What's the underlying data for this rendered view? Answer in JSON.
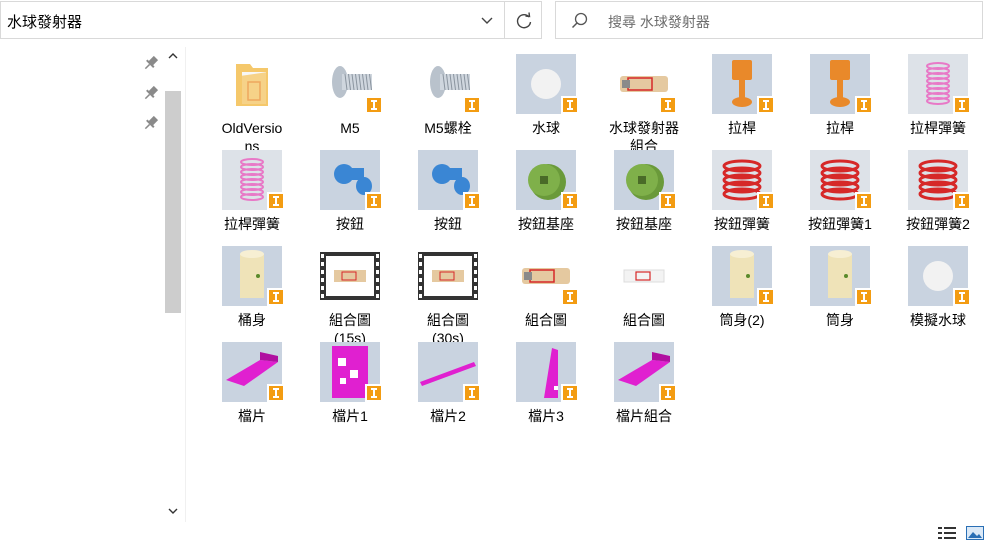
{
  "address": {
    "path": "水球發射器"
  },
  "search": {
    "placeholder": "搜尋 水球發射器"
  },
  "items": [
    {
      "label": "OldVersions",
      "display": "OldVersio\nns",
      "kind": "folder"
    },
    {
      "label": "M5",
      "kind": "screw"
    },
    {
      "label": "M5螺栓",
      "kind": "screw"
    },
    {
      "label": "水球",
      "kind": "ball"
    },
    {
      "label": "水球發射器組合",
      "display": "水球發射器\n組合",
      "kind": "assembly-cut"
    },
    {
      "label": "拉桿",
      "kind": "pull-rod"
    },
    {
      "label": "拉桿",
      "kind": "pull-rod"
    },
    {
      "label": "拉桿彈簧",
      "kind": "spring-pink"
    },
    {
      "label": "拉桿彈簧",
      "kind": "spring-pink"
    },
    {
      "label": "按鈕",
      "kind": "button-blue"
    },
    {
      "label": "按鈕",
      "kind": "button-blue"
    },
    {
      "label": "按鈕基座",
      "kind": "base-green"
    },
    {
      "label": "按鈕基座",
      "kind": "base-green"
    },
    {
      "label": "按鈕彈簧",
      "kind": "spring-red"
    },
    {
      "label": "按鈕彈簧1",
      "kind": "spring-red"
    },
    {
      "label": "按鈕彈簧2",
      "kind": "spring-red"
    },
    {
      "label": "桶身",
      "kind": "tube"
    },
    {
      "label": "組合圖(15s)",
      "display": "組合圖\n(15s)",
      "kind": "video"
    },
    {
      "label": "組合圖(30s)",
      "display": "組合圖\n(30s)",
      "kind": "video"
    },
    {
      "label": "組合圖",
      "kind": "assembly-cut"
    },
    {
      "label": "組合圖",
      "kind": "assembly-flat"
    },
    {
      "label": "筒身(2)",
      "kind": "tube"
    },
    {
      "label": "筒身",
      "kind": "tube"
    },
    {
      "label": "模擬水球",
      "kind": "ball"
    },
    {
      "label": "檔片",
      "kind": "plate-wedge"
    },
    {
      "label": "檔片1",
      "kind": "plate-square"
    },
    {
      "label": "檔片2",
      "kind": "plate-bar"
    },
    {
      "label": "檔片3",
      "kind": "plate-tri"
    },
    {
      "label": "檔片組合",
      "kind": "plate-wedge"
    }
  ],
  "colors": {
    "inventor_badge": "#f39c12",
    "folder": "#f5c86b",
    "spring_pink": "#e879c7",
    "spring_red": "#d62828",
    "button_blue": "#3a86d4",
    "base_green": "#6a9a3a",
    "plate_magenta": "#e020d0",
    "tube_cream": "#efe3b8",
    "rod_orange": "#e9892a"
  }
}
